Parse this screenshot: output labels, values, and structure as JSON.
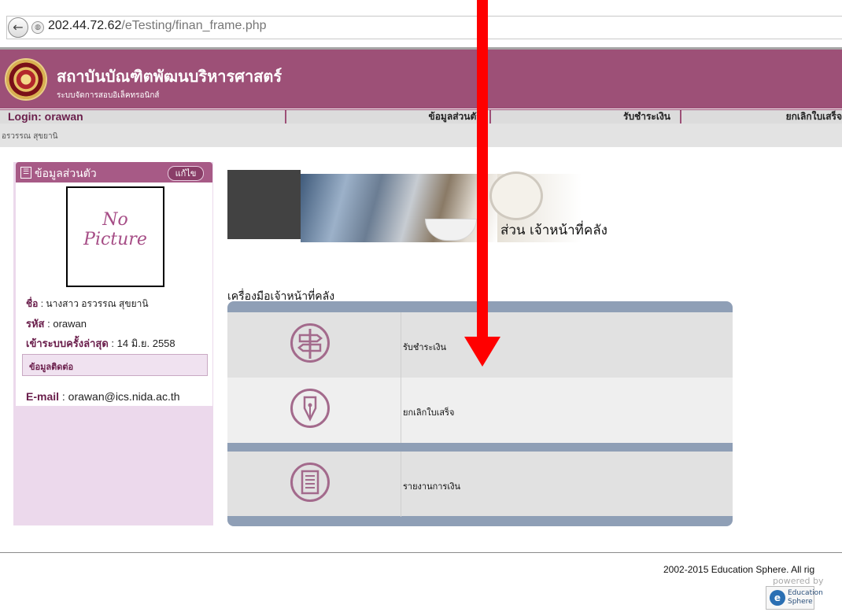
{
  "browser": {
    "url_host": "202.44.72.62",
    "url_path": "/eTesting/finan_frame.php"
  },
  "header": {
    "institution": "สถาบันบัณฑิตพัฒนบริหารศาสตร์",
    "system_name": "ระบบจัดการสอบอิเล็คทรอนิกส์"
  },
  "nav": {
    "login": "Login: orawan",
    "items": [
      "ข้อมูลส่วนตัว",
      "รับชำระเงิน",
      "ยกเลิกใบเสร็จ"
    ]
  },
  "user_bar": "อรวรรณ สุขยานิ",
  "sidebar": {
    "title": "ข้อมูลส่วนตัว",
    "edit": "แก้ไข",
    "photo_line1": "No",
    "photo_line2": "Picture",
    "name_label": "ชื่อ",
    "name_value": ": นางสาว อรวรรณ สุขยานิ",
    "id_label": "รหัส",
    "id_value": ": orawan",
    "last_login_label": "เข้าระบบครั้งล่าสุด",
    "last_login_value": ": 14 มิ.ย. 2558",
    "contact_title": "ข้อมูลติดต่อ",
    "email_label": "E-mail",
    "email_value": ": orawan@ics.nida.ac.th"
  },
  "banner": {
    "title": "ส่วน เจ้าหน้าที่คลัง"
  },
  "tools": {
    "title": "เครื่องมือเจ้าหน้าที่คลัง",
    "items": [
      {
        "label": "รับชำระเงิน",
        "icon": "signpost-icon"
      },
      {
        "label": "ยกเลิกใบเสร็จ",
        "icon": "pen-nib-icon"
      },
      {
        "label": "รายงานการเงิน",
        "icon": "report-document-icon"
      }
    ]
  },
  "footer": {
    "copyright": "2002-2015 Education Sphere. All rig",
    "powered": "powered by",
    "logo_line1": "Education",
    "logo_line2": "Sphere"
  },
  "colors": {
    "header": "#9d5077",
    "sidebar_bg": "#ecd9ec",
    "tool_frame": "#8f9fb6",
    "annotation_arrow": "#ff0000"
  }
}
